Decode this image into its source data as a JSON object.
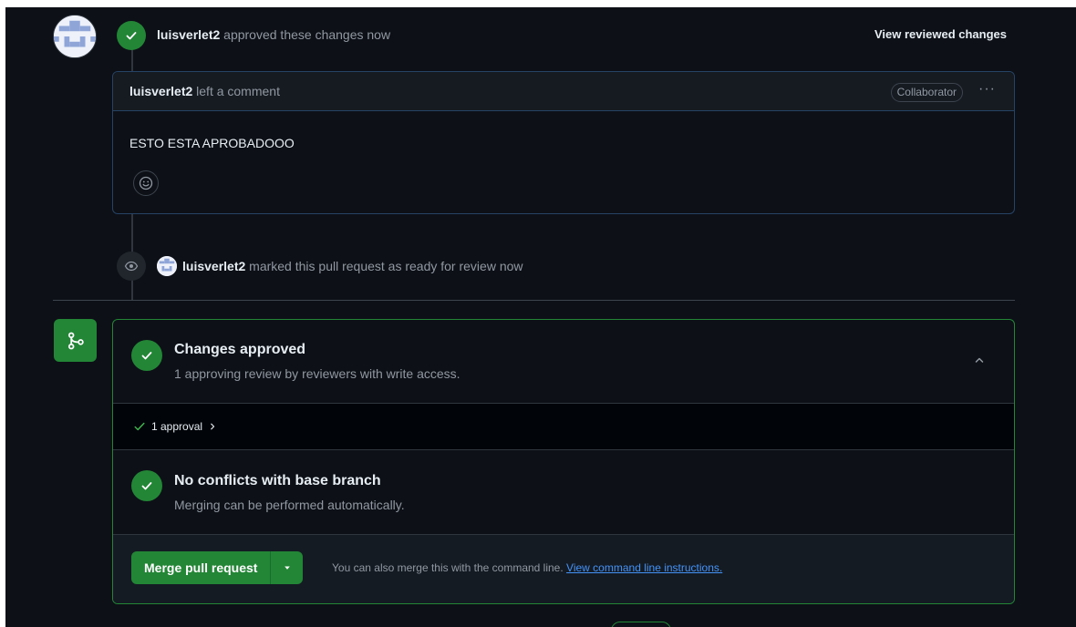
{
  "review": {
    "user": "luisverlet2",
    "action": "approved these changes now",
    "view_changes_label": "View reviewed changes"
  },
  "comment": {
    "user": "luisverlet2",
    "action": "left a comment",
    "badge": "Collaborator",
    "menu_label": "···",
    "body": "ESTO ESTA APROBADOOO"
  },
  "event": {
    "user": "luisverlet2",
    "action": "marked this pull request as ready for review now"
  },
  "merge": {
    "approved_title": "Changes approved",
    "approved_sub": "1 approving review by reviewers with write access.",
    "approvals_label": "1 approval",
    "conflicts_title": "No conflicts with base branch",
    "conflicts_sub": "Merging can be performed automatically.",
    "merge_button": "Merge pull request",
    "cmd_text": "You can also merge this with the command line.",
    "cmd_link": "View command line instructions."
  },
  "colors": {
    "background": "#0d1117",
    "success": "#238636",
    "link": "#4493f8",
    "muted": "#9198a1"
  },
  "icons": [
    "check-icon",
    "smiley-icon",
    "eye-icon",
    "git-merge-icon",
    "chevron-up-icon",
    "chevron-right-icon",
    "triangle-down-icon"
  ]
}
